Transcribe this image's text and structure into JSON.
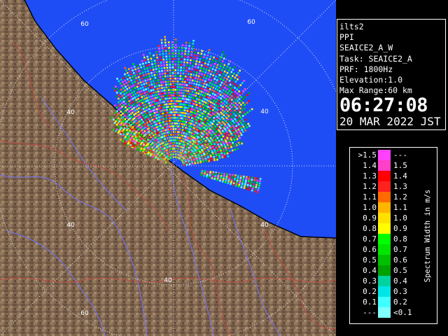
{
  "map": {
    "range_labels": [
      "60",
      "60",
      "40",
      "40",
      "40",
      "40",
      "40",
      "60"
    ],
    "colors": {
      "sea": "#1f4df5",
      "land": "#806650",
      "boundary": "#c04b40",
      "river": "#7575ff",
      "range_ring": "#ffffff"
    }
  },
  "info": {
    "site": "ilts2",
    "product": "PPI",
    "scan": "SEAICE2_A_W",
    "task": "Task: SEAICE2_A",
    "prf": "PRF: 1800Hz",
    "elevation": "Elevation:1.0",
    "max_range": "Max Range:60 km",
    "time": "06:27:08",
    "date": "20 MAR 2022 JST"
  },
  "legend": {
    "unit_label": "Spectrum Width in m/s",
    "rows": [
      {
        "lo": ">1.5",
        "hi": "---",
        "color": "#ff40ff"
      },
      {
        "lo": "1.4",
        "hi": "1.5",
        "color": "#ff40c8"
      },
      {
        "lo": "1.3",
        "hi": "1.4",
        "color": "#ff0000"
      },
      {
        "lo": "1.2",
        "hi": "1.3",
        "color": "#ff2020"
      },
      {
        "lo": "1.1",
        "hi": "1.2",
        "color": "#ff6a00"
      },
      {
        "lo": "1.0",
        "hi": "1.1",
        "color": "#ffb400"
      },
      {
        "lo": "0.9",
        "hi": "1.0",
        "color": "#ffe000"
      },
      {
        "lo": "0.8",
        "hi": "0.9",
        "color": "#ffff00"
      },
      {
        "lo": "0.7",
        "hi": "0.8",
        "color": "#00ff00"
      },
      {
        "lo": "0.6",
        "hi": "0.7",
        "color": "#00e600"
      },
      {
        "lo": "0.5",
        "hi": "0.6",
        "color": "#00c000"
      },
      {
        "lo": "0.4",
        "hi": "0.5",
        "color": "#00a000"
      },
      {
        "lo": "0.3",
        "hi": "0.4",
        "color": "#00d2a0"
      },
      {
        "lo": "0.2",
        "hi": "0.3",
        "color": "#00e6e6"
      },
      {
        "lo": "0.1",
        "hi": "0.2",
        "color": "#40ffff"
      },
      {
        "lo": "---",
        "hi": "<0.1",
        "color": "#80ffff"
      }
    ]
  }
}
